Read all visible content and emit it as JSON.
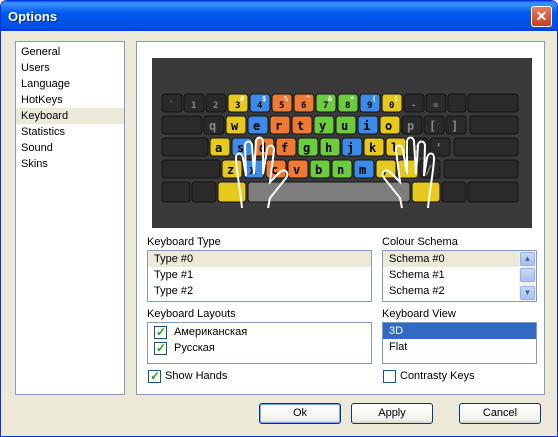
{
  "window": {
    "title": "Options",
    "close_glyph": "✕"
  },
  "sidebar": {
    "items": [
      {
        "label": "General"
      },
      {
        "label": "Users"
      },
      {
        "label": "Language"
      },
      {
        "label": "HotKeys"
      },
      {
        "label": "Keyboard",
        "selected": true
      },
      {
        "label": "Statistics"
      },
      {
        "label": "Sound"
      },
      {
        "label": "Skins"
      }
    ]
  },
  "keyboard_preview": {
    "row1": [
      "`",
      "1",
      "2",
      "3",
      "4",
      "5",
      "6",
      "7",
      "8",
      "9",
      "0",
      "-",
      "="
    ],
    "row1_shift": [
      "",
      "",
      "",
      "#",
      "$",
      "%",
      "^",
      "&",
      "*",
      "(",
      ")",
      "",
      ""
    ],
    "row2": [
      "q",
      "w",
      "e",
      "r",
      "t",
      "y",
      "u",
      "i",
      "o",
      "p",
      "[",
      "]"
    ],
    "row3": [
      "a",
      "s",
      "d",
      "f",
      "g",
      "h",
      "j",
      "k",
      "l",
      ";",
      "'"
    ],
    "row4": [
      "z",
      "x",
      "c",
      "v",
      "b",
      "n",
      "m",
      ",",
      ".",
      "/"
    ],
    "colors": {
      "background": "#3A3A3A",
      "dark_key": "#2A2A2A",
      "yellow": "#E7C81E",
      "blue": "#3D8BE8",
      "orange": "#EE7A36",
      "green": "#6CCB3E",
      "hands": "#FFFFFF"
    }
  },
  "keyboard_type": {
    "label": "Keyboard Type",
    "options": [
      "Type #0",
      "Type #1",
      "Type #2"
    ],
    "selected": "Type #0"
  },
  "colour_schema": {
    "label": "Colour Schema",
    "options": [
      "Schema #0",
      "Schema #1",
      "Schema #2"
    ],
    "selected": "Schema #0",
    "scroll_up_glyph": "▲",
    "scroll_down_glyph": "▼"
  },
  "keyboard_layouts": {
    "label": "Keyboard Layouts",
    "items": [
      {
        "label": "Американская",
        "checked": true
      },
      {
        "label": "Русская",
        "checked": true
      }
    ]
  },
  "keyboard_view": {
    "label": "Keyboard View",
    "options": [
      "3D",
      "Flat"
    ],
    "selected": "3D"
  },
  "show_hands": {
    "label": "Show Hands",
    "checked": true
  },
  "contrasty_keys": {
    "label": "Contrasty Keys",
    "checked": false
  },
  "buttons": {
    "ok": "Ok",
    "apply": "Apply",
    "cancel": "Cancel"
  },
  "check_glyph": "✓"
}
